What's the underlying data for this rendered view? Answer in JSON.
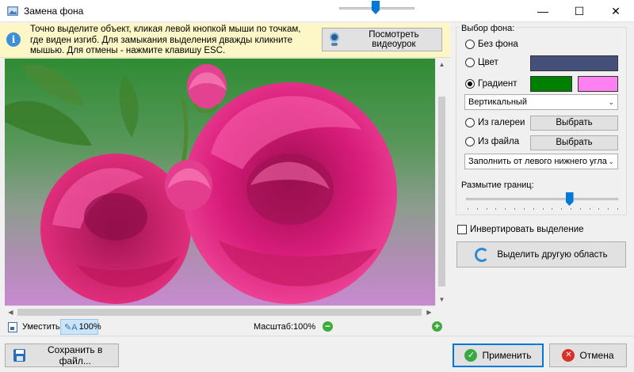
{
  "window": {
    "title": "Замена фона",
    "minimize_glyph": "—",
    "maximize_glyph": "☐",
    "close_glyph": "✕"
  },
  "info_banner": {
    "text": "Точно выделите объект, кликая левой кнопкой мыши по точкам, где виден изгиб. Для замыкания выделения дважды кликните мышью. Для отмены - нажмите клавишу ESC.",
    "video_button_label": "Посмотреть видеоурок"
  },
  "zoom_bar": {
    "fit_label": "Уместить",
    "actual_size_label": "100%",
    "scale_label": "Масштаб:",
    "scale_value": "100%"
  },
  "background_panel": {
    "title": "Выбор фона:",
    "options": {
      "no_background": "Без фона",
      "color": "Цвет",
      "gradient": "Градиент",
      "from_gallery": "Из галереи",
      "from_file": "Из файла"
    },
    "selected_option": "gradient",
    "color_swatch": "#44507a",
    "gradient_color_1": "#008000",
    "gradient_color_2": "#ff80f0",
    "gradient_direction": "Вертикальный",
    "gallery_button": "Выбрать",
    "file_button": "Выбрать",
    "fill_mode": "Заполнить от левого нижнего угла"
  },
  "edge_blur": {
    "label": "Размытие границ:",
    "level": 0.68
  },
  "invert_selection": {
    "label": "Инвертировать выделение",
    "checked": false
  },
  "select_other_button": "Выделить другую область",
  "footer": {
    "save_button": "Сохранить в файл...",
    "apply_button": "Применить",
    "cancel_button": "Отмена"
  },
  "icons": {
    "app": "app-icon",
    "info": "info-icon",
    "webcam": "webcam-icon",
    "fit": "fit-icon",
    "pen": "pen-icon",
    "zoom_out": "zoom-out-icon",
    "zoom_in": "zoom-in-icon",
    "refresh": "refresh-icon",
    "save": "floppy-icon",
    "ok": "check-icon",
    "cancel": "close-circle-icon"
  }
}
